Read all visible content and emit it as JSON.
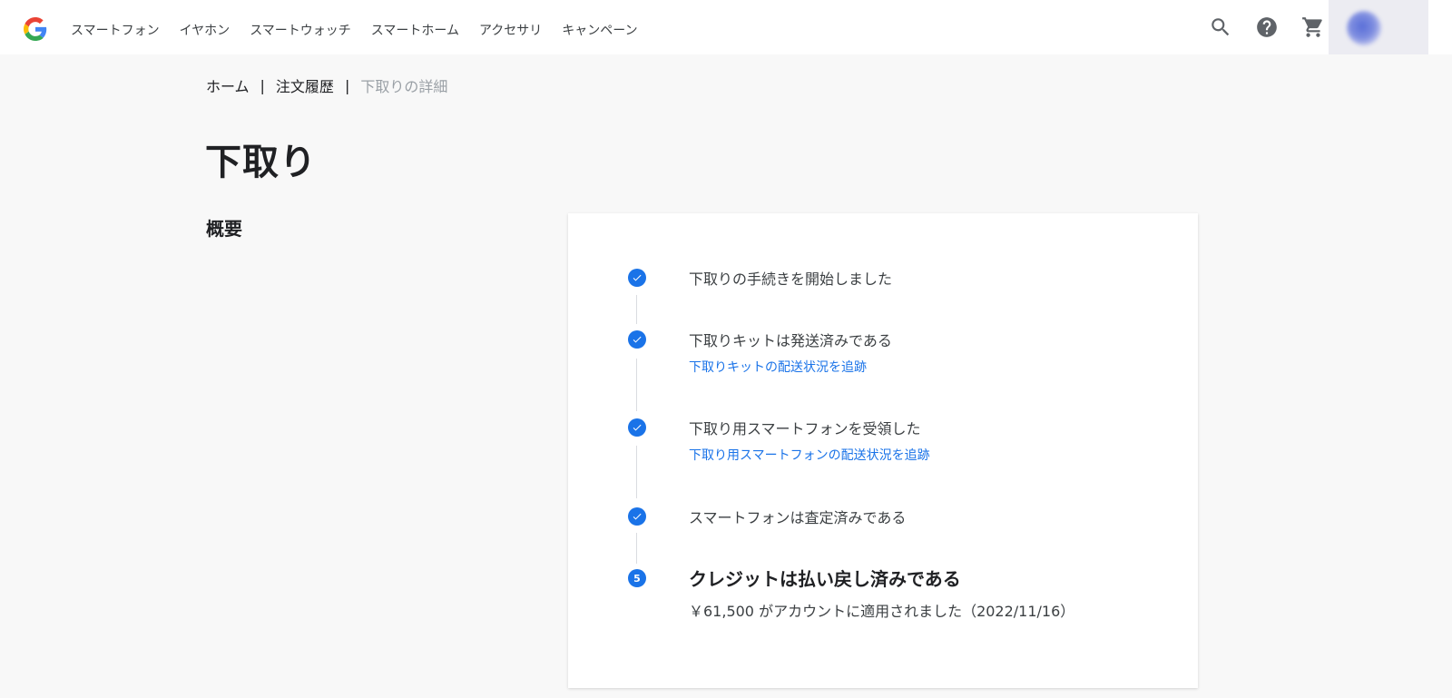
{
  "header": {
    "nav": [
      "スマートフォン",
      "イヤホン",
      "スマートウォッチ",
      "スマートホーム",
      "アクセサリ",
      "キャンペーン"
    ],
    "icons": [
      "search-icon",
      "help-icon",
      "cart-icon"
    ]
  },
  "breadcrumb": {
    "home": "ホーム",
    "sep1": "|",
    "orders": "注文履歴",
    "sep2": "|",
    "current": "下取りの詳細"
  },
  "page": {
    "title": "下取り",
    "section": "概要"
  },
  "steps": [
    {
      "status": "done",
      "title": "下取りの手続きを開始しました"
    },
    {
      "status": "done",
      "title": "下取りキットは発送済みである",
      "link": "下取りキットの配送状況を追跡"
    },
    {
      "status": "done",
      "title": "下取り用スマートフォンを受領した",
      "link": "下取り用スマートフォンの配送状況を追跡"
    },
    {
      "status": "done",
      "title": "スマートフォンは査定済みである"
    },
    {
      "status": "current",
      "number": "5",
      "title": "クレジットは払い戻し済みである",
      "detail": "￥61,500 がアカウントに適用されました（2022/11/16）"
    }
  ],
  "colors": {
    "accent": "#1a73e8",
    "background": "#f8f8f8"
  }
}
